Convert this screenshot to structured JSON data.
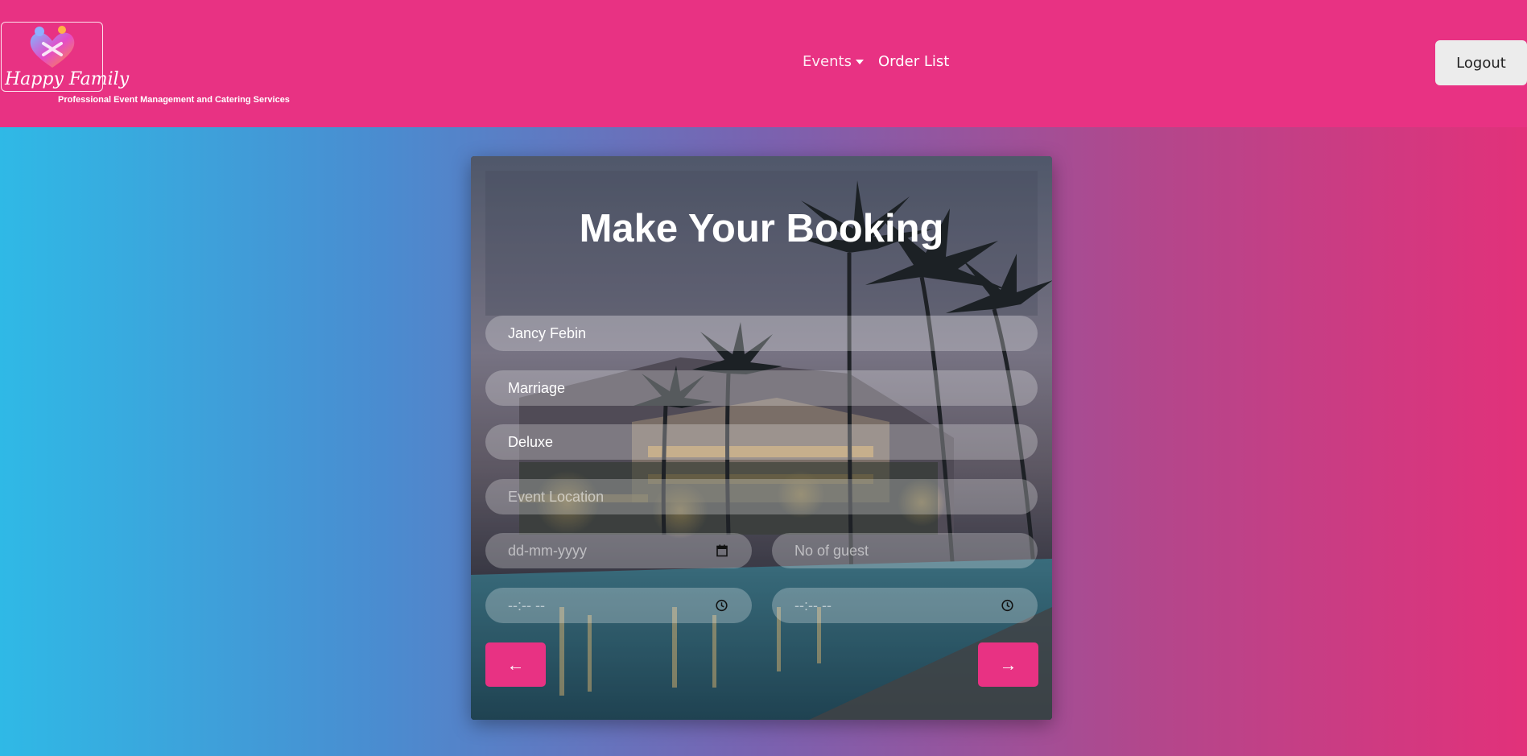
{
  "brand": {
    "name": "Happy Family",
    "tagline": "Professional Event Management and Catering Services",
    "logo_icon": "heart-people-logo-icon"
  },
  "nav": {
    "events_label": "Events",
    "order_list_label": "Order List",
    "logout_label": "Logout"
  },
  "form": {
    "title": "Make Your Booking",
    "name_value": "Jancy Febin",
    "event_value": "Marriage",
    "package_value": "Deluxe",
    "location_placeholder": "Event Location",
    "date_placeholder": "dd-mm-yyyy",
    "guests_placeholder": "No of guest",
    "start_time_placeholder": "--:-- --",
    "end_time_placeholder": "--:-- --",
    "back_arrow": "←",
    "next_arrow": "→"
  },
  "colors": {
    "navbar": "#e83283",
    "accent": "#e83283",
    "gradient_left": "#2fb9e6",
    "gradient_right": "#e2317a"
  }
}
